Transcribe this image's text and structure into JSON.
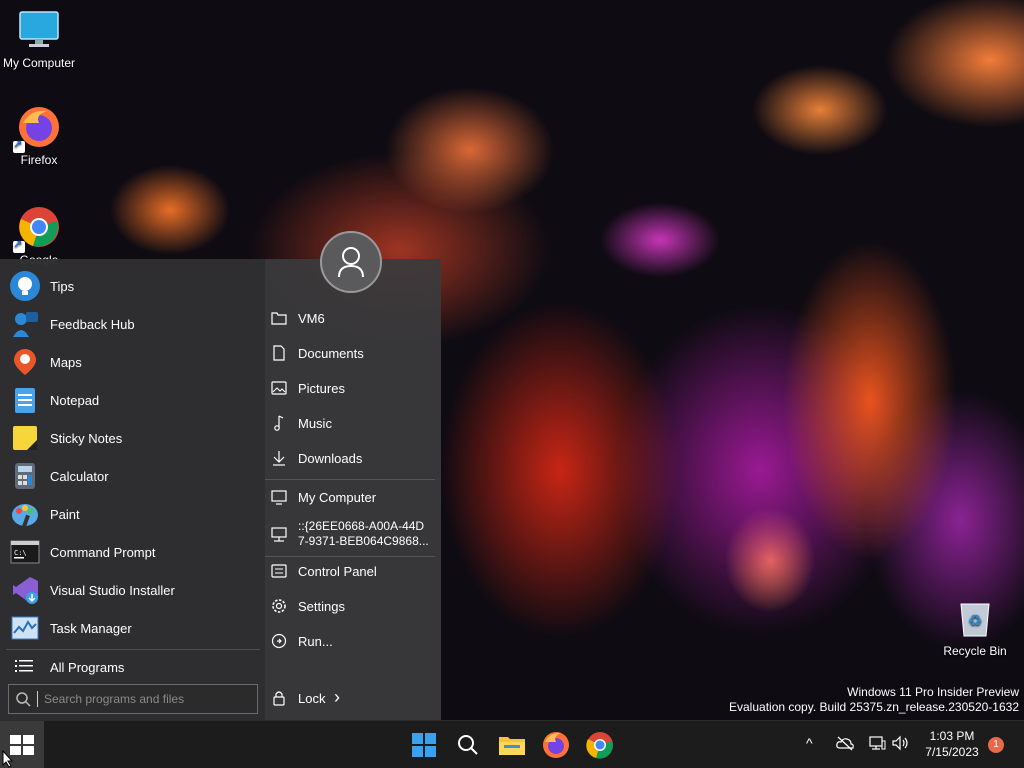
{
  "desktop": {
    "icons": [
      {
        "label": "My Computer",
        "icon": "monitor-icon"
      },
      {
        "label": "Firefox",
        "icon": "firefox-icon"
      },
      {
        "label": "Google",
        "icon": "chrome-icon"
      },
      {
        "label": "Recycle Bin",
        "icon": "recycle-bin-icon"
      }
    ]
  },
  "start_menu": {
    "apps": [
      {
        "label": "Tips",
        "icon": "tips-icon"
      },
      {
        "label": "Feedback Hub",
        "icon": "feedback-hub-icon"
      },
      {
        "label": "Maps",
        "icon": "maps-icon"
      },
      {
        "label": "Notepad",
        "icon": "notepad-icon"
      },
      {
        "label": "Sticky Notes",
        "icon": "sticky-notes-icon"
      },
      {
        "label": "Calculator",
        "icon": "calculator-icon"
      },
      {
        "label": "Paint",
        "icon": "paint-icon"
      },
      {
        "label": "Command Prompt",
        "icon": "command-prompt-icon"
      },
      {
        "label": "Visual Studio Installer",
        "icon": "visual-studio-installer-icon"
      },
      {
        "label": "Task Manager",
        "icon": "task-manager-icon"
      }
    ],
    "all_programs": "All Programs",
    "search_placeholder": "Search programs and files",
    "places": [
      {
        "label": "VM6",
        "icon": "folder-icon"
      },
      {
        "label": "Documents",
        "icon": "document-icon"
      },
      {
        "label": "Pictures",
        "icon": "picture-icon"
      },
      {
        "label": "Music",
        "icon": "music-icon"
      },
      {
        "label": "Downloads",
        "icon": "download-icon"
      },
      {
        "label": "My Computer",
        "icon": "computer-icon"
      },
      {
        "label_line1": "::{26EE0668-A00A-44D",
        "label_line2": "7-9371-BEB064C9868...",
        "icon": "network-icon"
      },
      {
        "label": "Control Panel",
        "icon": "control-panel-icon"
      },
      {
        "label": "Settings",
        "icon": "gear-icon"
      },
      {
        "label": "Run...",
        "icon": "run-icon"
      }
    ],
    "lock_label": "Lock",
    "lock_arrow": "›"
  },
  "watermark": {
    "line1": "Windows 11 Pro Insider Preview",
    "line2": "Evaluation copy. Build 25375.zn_release.230520-1632"
  },
  "taskbar": {
    "pinned": [
      "windows-start-icon",
      "search-icon",
      "file-explorer-icon",
      "firefox-icon",
      "chrome-icon"
    ],
    "time": "1:03 PM",
    "date": "7/15/2023",
    "notification_count": "1",
    "chevron": "^"
  }
}
